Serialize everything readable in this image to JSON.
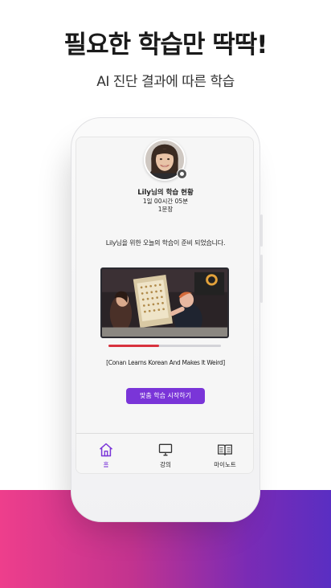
{
  "headline": "필요한 학습만 딱딱!",
  "subline": "AI 진단 결과에 따른 학습",
  "profile": {
    "status_title": "Lily님의 학습 현황",
    "study_time": "1일 00시간 05분",
    "sentences": "1문장"
  },
  "ready_message": "Lily님을 위한 오늘의 학습이 준비 되었습니다.",
  "video": {
    "caption": "[Conan Learns Korean And Makes It Weird]",
    "progress": 0.45,
    "progress_color": "#d8323e"
  },
  "start_button": {
    "label": "맞춤 학습 시작하기",
    "color": "#7a35d8"
  },
  "tabbar": {
    "items": [
      {
        "label": "홈",
        "icon": "home-icon",
        "active": true
      },
      {
        "label": "강의",
        "icon": "monitor-icon",
        "active": false
      },
      {
        "label": "마이노트",
        "icon": "notebook-icon",
        "active": false
      }
    ]
  },
  "colors": {
    "accent": "#7a35d8",
    "gradient_start": "#ee3e8c",
    "gradient_end": "#5a2ec2"
  }
}
